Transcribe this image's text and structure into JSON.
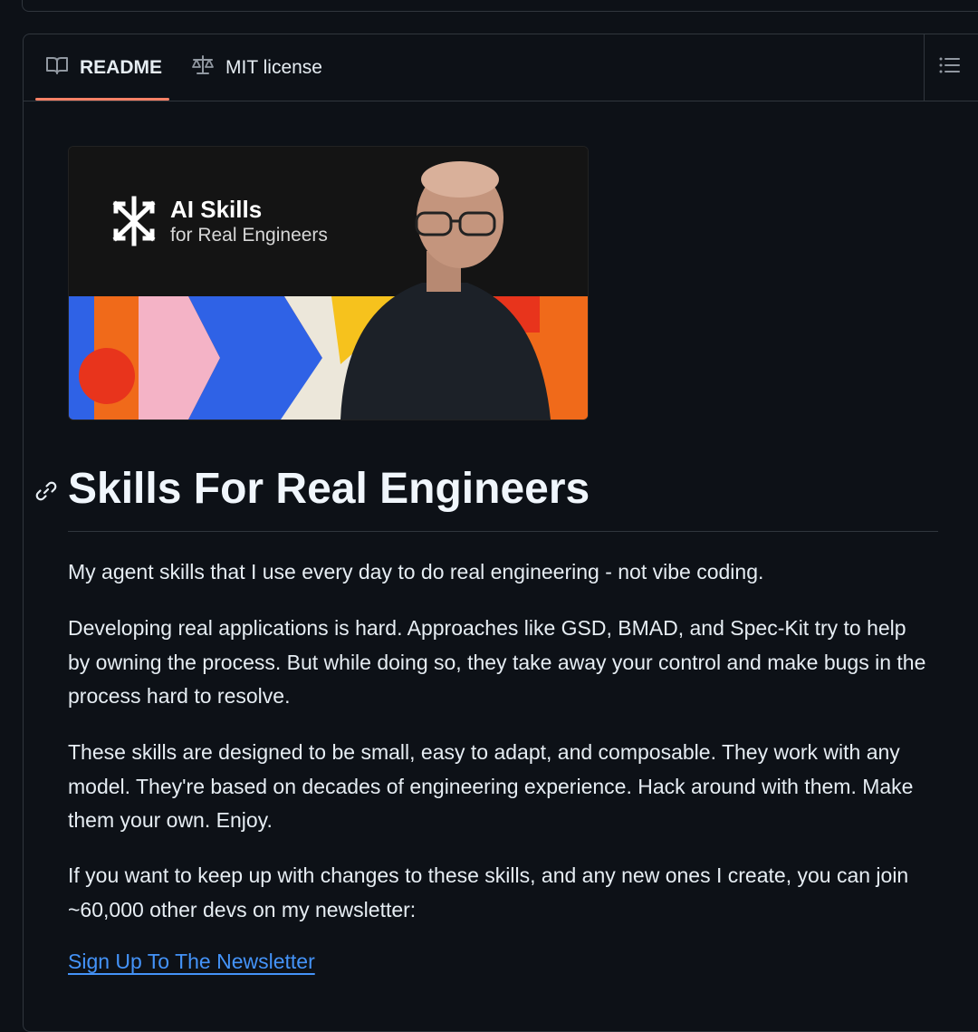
{
  "tabs": [
    {
      "label": "README",
      "icon": "book-icon",
      "active": true
    },
    {
      "label": "MIT license",
      "icon": "scale-icon",
      "active": false
    }
  ],
  "banner": {
    "title": "AI Skills",
    "subtitle": "for Real Engineers"
  },
  "heading": "Skills For Real Engineers",
  "paragraphs": [
    "My agent skills that I use every day to do real engineering - not vibe coding.",
    "Developing real applications is hard. Approaches like GSD, BMAD, and Spec-Kit try to help by owning the process. But while doing so, they take away your control and make bugs in the process hard to resolve.",
    "These skills are designed to be small, easy to adapt, and composable. They work with any model. They're based on decades of engineering experience. Hack around with them. Make them your own. Enjoy.",
    "If you want to keep up with changes to these skills, and any new ones I create, you can join ~60,000 other devs on my newsletter:"
  ],
  "newsletter_link": "Sign Up To The Newsletter",
  "colors": {
    "background": "#0d1117",
    "border": "#30363d",
    "active_tab_underline": "#f78166",
    "link": "#4493f8"
  }
}
